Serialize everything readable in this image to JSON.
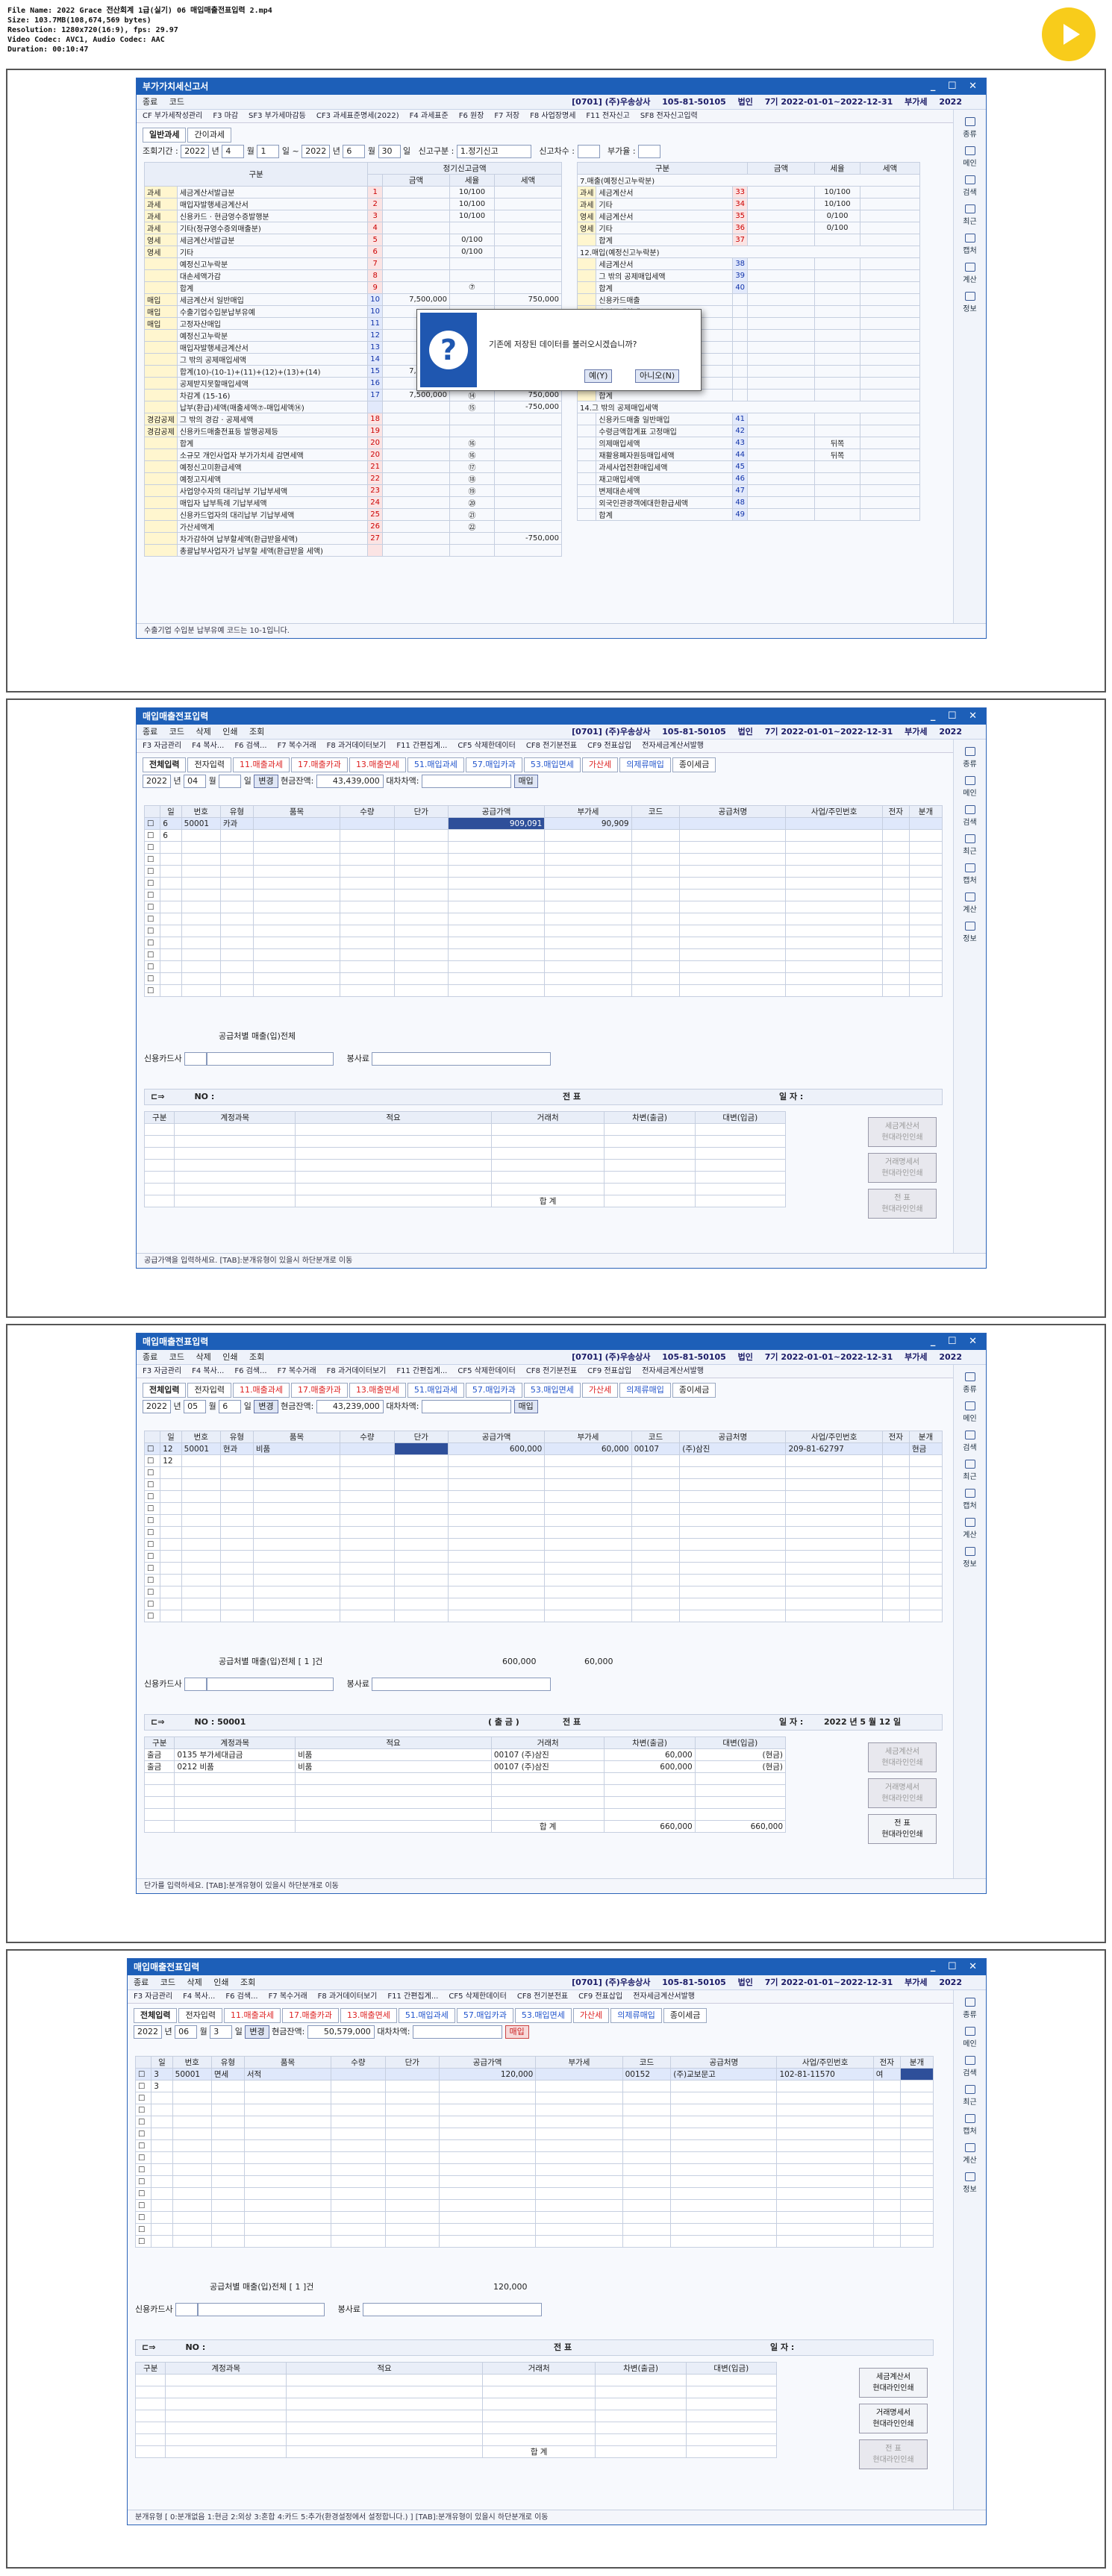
{
  "fileinfo": {
    "line1": "File Name: 2022 Grace 전산회계 1급(실기) 06 매입매출전표입력 2.mp4",
    "line2": "Size: 103.7MB(108,674,569 bytes)",
    "line3": "Resolution: 1280x720(16:9), fps: 29.97",
    "line4": "Video Codec: AVC1, Audio Codec: AAC",
    "line5": "Duration: 00:10:47"
  },
  "company": "[0701] (주)우송상사",
  "bizno": "105-81-50105",
  "corptype": "법인",
  "term": "7기 2022-01-01~2022-12-31",
  "vatlabel": "부가세",
  "year": "2022",
  "sidebar": [
    "종류",
    "메인",
    "검색",
    "최근",
    "캡처",
    "계산",
    "정보"
  ],
  "toolbar": {
    "close": "종료",
    "code": "코드",
    "delete": "삭제",
    "print": "인쇄",
    "lookup": "조회"
  },
  "fbar": [
    "F3 자금관리",
    "F4 복사...",
    "F6 검색...",
    "F7 복수거래",
    "F8 과거데이터보기",
    "F11 간편집계...",
    "CF5 삭제한데이터",
    "CF8 전기분전표",
    "CF9 전표삽입",
    "전자세금계산서발행"
  ],
  "tabs": [
    {
      "label": "전체입력",
      "c": "sel"
    },
    {
      "label": "전자입력",
      "c": ""
    },
    {
      "label": "11.매출과세",
      "c": "red"
    },
    {
      "label": "17.매출카과",
      "c": "red"
    },
    {
      "label": "13.매출면세",
      "c": "red"
    },
    {
      "label": "51.매입과세",
      "c": "blue"
    },
    {
      "label": "57.매입카과",
      "c": "blue"
    },
    {
      "label": "53.매입면세",
      "c": "blue"
    },
    {
      "label": "가산세",
      "c": "red"
    },
    {
      "label": "의제류매입",
      "c": "blue"
    },
    {
      "label": "종이세금",
      "c": ""
    }
  ],
  "gridheaders": [
    "일",
    "번호",
    "유형",
    "품목",
    "수량",
    "단가",
    "공급가액",
    "부가세",
    "코드",
    "공급처명",
    "사업/주민번호",
    "전자",
    "분개"
  ],
  "jheaders": [
    "구분",
    "계정과목",
    "적요",
    "거래처",
    "차변(출금)",
    "대변(입금)"
  ],
  "labels": {
    "year_suffix": "년",
    "month_suffix": "월",
    "day_suffix": "일",
    "change": "변경",
    "cash_balance": "현금잔액:",
    "debit_credit_diff": "대차차액:",
    "purchase": "매입",
    "card_company": "신용카드사",
    "service_charge": "봉사료",
    "no": "NO :",
    "voucher": "전 표",
    "date": "일 자 :",
    "total": "합 계",
    "year_word": "년",
    "month_word": "월",
    "day_word": "일",
    "tb_credit_sub": "세금계산서\n현대라인인쇄",
    "tb_trade": "거래명세서\n현대라인인쇄",
    "tb_voucher": "전 표\n현대라인인쇄"
  },
  "vat": {
    "title": "부가가치세신고서",
    "fbar": [
      "CF 부가세작성관리",
      "F3 마감",
      "SF3 부가세마감등",
      "CF3 과세표준명세(2022)",
      "F4 과세표준",
      "F6 원장",
      "F7 저장",
      "F8 사업장명세",
      "F11 전자신고",
      "SF8 전자신고입력"
    ],
    "tabs": [
      "일반과세",
      "간이과세"
    ],
    "period_label": "조회기간 :",
    "y1": "2022",
    "m1": "4",
    "d1": "1",
    "y2": "2022",
    "m2": "6",
    "d2": "30",
    "report_type_label": "신고구분 :",
    "report_type": "1.정기신고",
    "report_no_label": "신고차수 :",
    "rate_label": "부가율 :",
    "regular_title": "정기신고금액",
    "col_div": "구분",
    "col_amount": "금액",
    "col_rate": "세율",
    "col_tax": "세액",
    "left_rows": [
      [
        "과세",
        "세금계산서발급분",
        "1",
        "",
        "10/100",
        ""
      ],
      [
        "과세",
        "매입자발행세금계산서",
        "2",
        "",
        "10/100",
        ""
      ],
      [
        "과세",
        "신용카드 · 현금영수증발행분",
        "3",
        "",
        "10/100",
        ""
      ],
      [
        "과세",
        "기타(정규영수증외매출분)",
        "4",
        "",
        "",
        ""
      ],
      [
        "영세",
        "세금계산서발급분",
        "5",
        "",
        "0/100",
        ""
      ],
      [
        "영세",
        "기타",
        "6",
        "",
        "0/100",
        ""
      ],
      [
        "",
        "예정신고누락분",
        "7",
        "",
        "",
        ""
      ],
      [
        "",
        "대손세액가감",
        "8",
        "",
        "",
        ""
      ],
      [
        "",
        "합계",
        "9",
        "",
        "⑦",
        ""
      ],
      [
        "매입",
        "세금계산서 일반매입",
        "10",
        "7,500,000",
        "",
        "750,000"
      ],
      [
        "매입",
        "수출기업수입분납부유예",
        "10",
        "",
        "",
        ""
      ],
      [
        "매입",
        "고정자산매입",
        "11",
        "",
        "",
        ""
      ],
      [
        "",
        "예정신고누락분",
        "12",
        "",
        "",
        ""
      ],
      [
        "",
        "매입자발행세금계산서",
        "13",
        "",
        "",
        ""
      ],
      [
        "",
        "그 밖의 공제매입세액",
        "14",
        "",
        "",
        ""
      ],
      [
        "",
        "합계(10)-(10-1)+(11)+(12)+(13)+(14)",
        "15",
        "7,500,000",
        "",
        "750,000"
      ],
      [
        "",
        "공제받지못할매입세액",
        "16",
        "",
        "",
        ""
      ],
      [
        "",
        "차감계 (15-16)",
        "17",
        "7,500,000",
        "⑭",
        "750,000"
      ],
      [
        "",
        "납부(환급)세액(매출세액⑦-매입세액⑭)",
        "",
        "",
        "⑮",
        "-750,000"
      ],
      [
        "경감공제",
        "그 밖의 경감 · 공제세액",
        "18",
        "",
        "",
        ""
      ],
      [
        "경감공제",
        "신용카드매출전표등 발행공제등",
        "19",
        "",
        "",
        ""
      ],
      [
        "",
        "합계",
        "20",
        "",
        "⑯",
        ""
      ],
      [
        "",
        "소규모 개인사업자 부가가치세 감면세액",
        "20",
        "",
        "⑯",
        ""
      ],
      [
        "",
        "예정신고미환급세액",
        "21",
        "",
        "⑰",
        ""
      ],
      [
        "",
        "예정고지세액",
        "22",
        "",
        "⑱",
        ""
      ],
      [
        "",
        "사업양수자의 대리납부 기납부세액",
        "23",
        "",
        "⑲",
        ""
      ],
      [
        "",
        "매입자 납부특례 기납부세액",
        "24",
        "",
        "⑳",
        ""
      ],
      [
        "",
        "신용카드업자의 대리납부 기납부세액",
        "25",
        "",
        "㉑",
        ""
      ],
      [
        "",
        "가산세액계",
        "26",
        "",
        "㉒",
        ""
      ],
      [
        "",
        "차가감하여 납부할세액(환급받을세액)",
        "27",
        "",
        "",
        "-750,000"
      ],
      [
        "",
        "총괄납부사업자가 납부할 세액(환급받을 세액)",
        "",
        "",
        "",
        ""
      ]
    ],
    "right_title": "7.매출(예정신고누락분)",
    "right_rows": [
      [
        "과세",
        "세금계산서",
        "33",
        "",
        "10/100",
        ""
      ],
      [
        "과세",
        "기타",
        "34",
        "",
        "10/100",
        ""
      ],
      [
        "영세",
        "세금계산서",
        "35",
        "",
        "0/100",
        ""
      ],
      [
        "영세",
        "기타",
        "36",
        "",
        "0/100",
        ""
      ],
      [
        "",
        "합계",
        "37",
        "",
        "",
        ""
      ]
    ],
    "right_title2": "12.매입(예정신고누락분)",
    "right_rows2": [
      [
        "세금계산서",
        "38"
      ],
      [
        "그 밖의 공제매입세액",
        "39"
      ],
      [
        "합계",
        "40"
      ]
    ],
    "right_rows2b": [
      "신용카드매출",
      "수령금액합계",
      "의제매입세액",
      "재활용폐자원등매입세액",
      "과세사업전환매입세액",
      "재고매입세액",
      "변제대손세액",
      "외국인관광객에대한환급",
      "합계"
    ],
    "right_title3": "14.그 밖의 공제매입세액",
    "right_rows3": [
      [
        "신용카드매출 일반매입",
        "41",
        ""
      ],
      [
        "수령금액합계표 고정매입",
        "42",
        ""
      ],
      [
        "의제매입세액",
        "43",
        "뒤쪽"
      ],
      [
        "재활용폐자원등매입세액",
        "44",
        "뒤쪽"
      ],
      [
        "과세사업전환매입세액",
        "45",
        ""
      ],
      [
        "재고매입세액",
        "46",
        ""
      ],
      [
        "변제대손세액",
        "47",
        ""
      ],
      [
        "외국인관광객에대한환급세액",
        "48",
        ""
      ],
      [
        "합계",
        "49",
        ""
      ]
    ],
    "dialog": {
      "message": "기존에 저장된 데이터를 불러오시겠습니까?",
      "yes": "예(Y)",
      "no": "아니오(N)"
    },
    "status": "수출기업 수입분 납부유예 코드는 10-1입니다."
  },
  "win2": {
    "title": "매입매출전표입력",
    "year": "2022",
    "month": "04",
    "day": "",
    "cash": "43,439,000",
    "row": {
      "day": "6",
      "no": "50001",
      "type": "카과",
      "item": "",
      "qty": "",
      "price": "",
      "supply": "909,091",
      "vat": "90,909",
      "code": "",
      "vendor": "",
      "biz": "",
      "elec": "",
      "jr": ""
    },
    "row2day": "6",
    "footer_label": "공급처별 매출(입)전체",
    "status": "공급가액을 입력하세요. [TAB]:분개유형이 있을시 하단분개로 이동"
  },
  "win3": {
    "title": "매입매출전표입력",
    "year": "2022",
    "month": "05",
    "day": "6",
    "cash": "43,239,000",
    "row": {
      "day": "12",
      "no": "50001",
      "type": "현과",
      "item": "비품",
      "qty": "",
      "price": "",
      "supply": "600,000",
      "vat": "60,000",
      "code": "00107",
      "vendor": "(주)삼진",
      "biz": "209-81-62797",
      "elec": "",
      "jr": "현금"
    },
    "row2day": "12",
    "footer_label": "공급처별 매출(입)전체 [ 1 ]건",
    "footer_supply": "600,000",
    "footer_vat": "60,000",
    "vno": "50001",
    "vtype": "( 출 금 )",
    "vdate": "2022 년 5 월 12 일",
    "jrows": [
      [
        "출금",
        "0135 부가세대급금",
        "비품",
        "00107 (주)삼진",
        "60,000",
        "(현금)"
      ],
      [
        "출금",
        "0212 비품",
        "비품",
        "00107 (주)삼진",
        "600,000",
        "(현금)"
      ]
    ],
    "jtotal_debit": "660,000",
    "jtotal_credit": "660,000",
    "status": "단가를 입력하세요. [TAB]:분개유형이 있을시 하단분개로 이동"
  },
  "win4": {
    "title": "매입매출전표입력",
    "year": "2022",
    "month": "06",
    "day": "3",
    "cash": "50,579,000",
    "row": {
      "day": "3",
      "no": "50001",
      "type": "면세",
      "item": "서적",
      "qty": "",
      "price": "",
      "supply": "120,000",
      "vat": "",
      "code": "00152",
      "vendor": "(주)교보문고",
      "biz": "102-81-11570",
      "elec": "여",
      "jr": ""
    },
    "row2day": "3",
    "footer_label": "공급처별 매출(입)전체 [ 1 ]건",
    "footer_supply": "120,000",
    "status": "분개유형 [ 0:분개없음 1:현금 2:외상 3:혼합 4:카드 5:추가(환경설정에서 설정합니다.) ]     [TAB]:분개유형이 있을시 하단분개로 이동"
  }
}
